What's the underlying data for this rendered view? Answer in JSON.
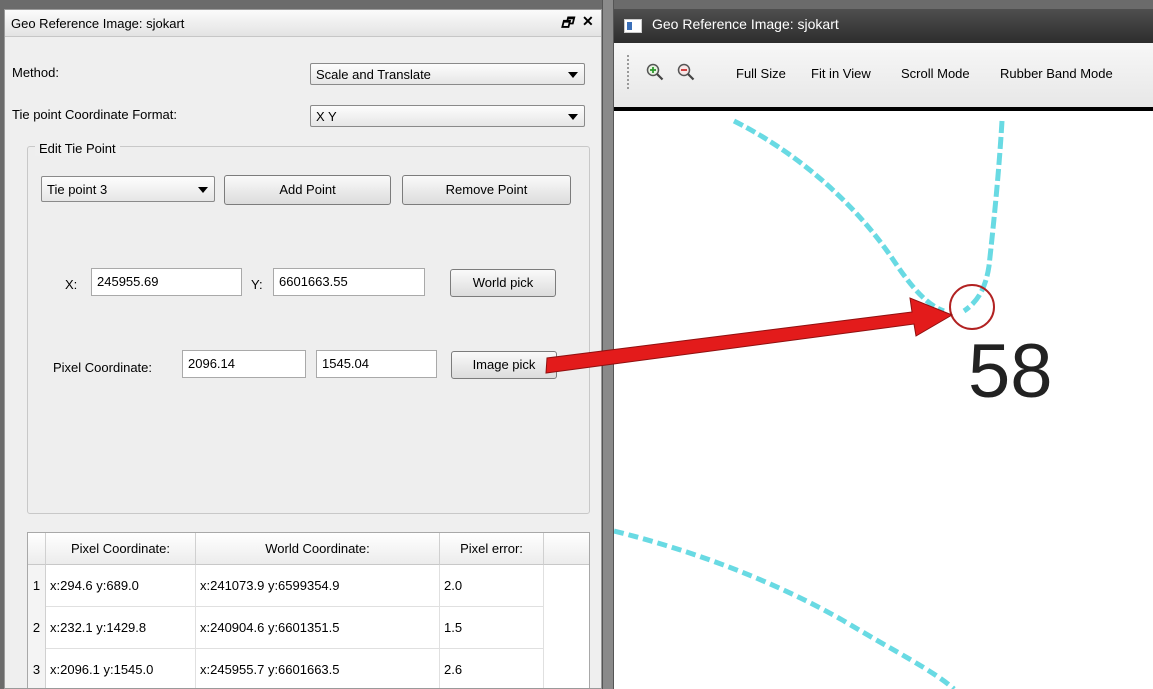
{
  "left_panel": {
    "title": "Geo Reference Image: sjokart",
    "method_label": "Method:",
    "method_value": "Scale and Translate",
    "format_label": "Tie point Coordinate Format:",
    "format_value": "X Y",
    "edit_group_title": "Edit Tie Point",
    "tie_point_select": "Tie point 3",
    "add_point": "Add Point",
    "remove_point": "Remove Point",
    "x_label": "X:",
    "x_value": "245955.69",
    "y_label": "Y:",
    "y_value": "6601663.55",
    "world_pick": "World pick",
    "pixel_label": "Pixel Coordinate:",
    "pixel_x": "2096.14",
    "pixel_y": "1545.04",
    "image_pick": "Image pick"
  },
  "table": {
    "headers": [
      "Pixel Coordinate:",
      "World Coordinate:",
      "Pixel error:"
    ],
    "rows": [
      {
        "num": "1",
        "pixel": "x:294.6 y:689.0",
        "world": "x:241073.9  y:6599354.9",
        "error": "2.0"
      },
      {
        "num": "2",
        "pixel": "x:232.1 y:1429.8",
        "world": "x:240904.6  y:6601351.5",
        "error": "1.5"
      },
      {
        "num": "3",
        "pixel": "x:2096.1 y:1545.0",
        "world": "x:245955.7  y:6601663.5",
        "error": "2.6"
      }
    ]
  },
  "right_window": {
    "title": "Geo Reference Image: sjokart",
    "toolbar": [
      "Full Size",
      "Fit in View",
      "Scroll Mode",
      "Rubber Band Mode"
    ],
    "map_label": "58"
  },
  "colors": {
    "annotation_arrow": "#e31b1b",
    "tie_marker": "#b22222",
    "map_line": "#4fd4de"
  }
}
